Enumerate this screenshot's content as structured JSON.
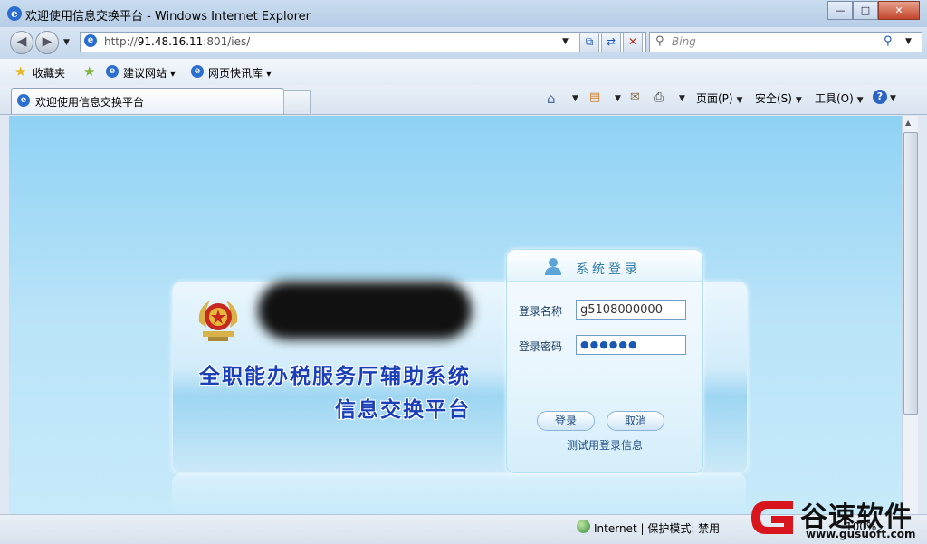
{
  "window": {
    "title": "欢迎使用信息交换平台 - Windows Internet Explorer",
    "minimize": "—",
    "maximize": "□",
    "close": "✕"
  },
  "nav": {
    "back": "◀",
    "forward": "▶",
    "address_prefix": "http://",
    "address_host": "91.48.16.11",
    "address_rest": ":801/ies/",
    "search_placeholder": "Bing"
  },
  "favorites": {
    "label": "收藏夹",
    "items": [
      "建议网站 ▾",
      "网页快讯库 ▾"
    ]
  },
  "tab": {
    "label": "欢迎使用信息交换平台"
  },
  "commandbar": {
    "page": "页面(P)",
    "safety": "安全(S)",
    "tools": "工具(O)"
  },
  "page": {
    "system_title": "全职能办税服务厅辅助系统",
    "platform_title": "信息交换平台",
    "login": {
      "title": "系统登录",
      "username_label": "登录名称",
      "username_value": "g5108000000",
      "password_label": "登录密码",
      "password_value": "●●●●●●",
      "login_button": "登录",
      "cancel_button": "取消",
      "test_link": "测试用登录信息"
    }
  },
  "status": {
    "zone": "Internet | 保护模式: 禁用",
    "zoom": "100%"
  },
  "watermark": {
    "name": "谷速软件",
    "url": "www.gusuoft.com"
  },
  "colors": {
    "page_bg": "#9dd7f5",
    "title_text": "#1a3fb8",
    "accent": "#337ca8"
  }
}
